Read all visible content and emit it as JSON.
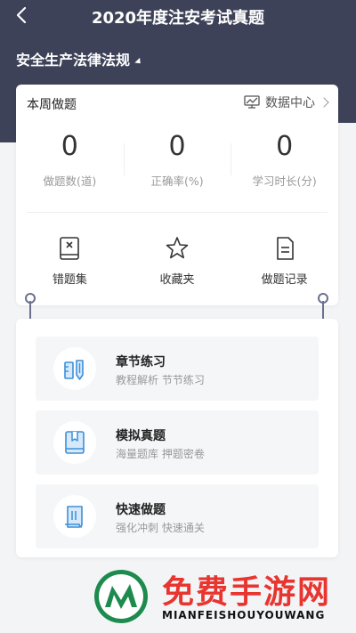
{
  "header": {
    "title": "2020年度注安考试真题",
    "subject": "安全生产法律法规"
  },
  "week": {
    "title": "本周做题",
    "data_center": "数据中心",
    "stats": [
      {
        "value": "0",
        "label": "做题数(道)"
      },
      {
        "value": "0",
        "label": "正确率(%)"
      },
      {
        "value": "0",
        "label": "学习时长(分)"
      }
    ],
    "links": [
      {
        "label": "错题集",
        "icon": "wrong-book-icon"
      },
      {
        "label": "收藏夹",
        "icon": "star-icon"
      },
      {
        "label": "做题记录",
        "icon": "record-icon"
      }
    ]
  },
  "modules": [
    {
      "title": "章节练习",
      "desc": "教程解析 节节练习",
      "icon": "pencil-ruler-icon"
    },
    {
      "title": "模拟真题",
      "desc": "海量题库 押题密卷",
      "icon": "book-icon"
    },
    {
      "title": "快速做题",
      "desc": "强化冲刺 快速通关",
      "icon": "scroll-icon"
    }
  ],
  "watermark": {
    "title": "免费手游网",
    "subtitle": "MIANFEISHOUYOUWANG"
  },
  "colors": {
    "header": "#3e4258",
    "accent_icon": "#3c8fd9",
    "watermark_red": "#e8352f",
    "logo_green": "#1d8a4e"
  }
}
